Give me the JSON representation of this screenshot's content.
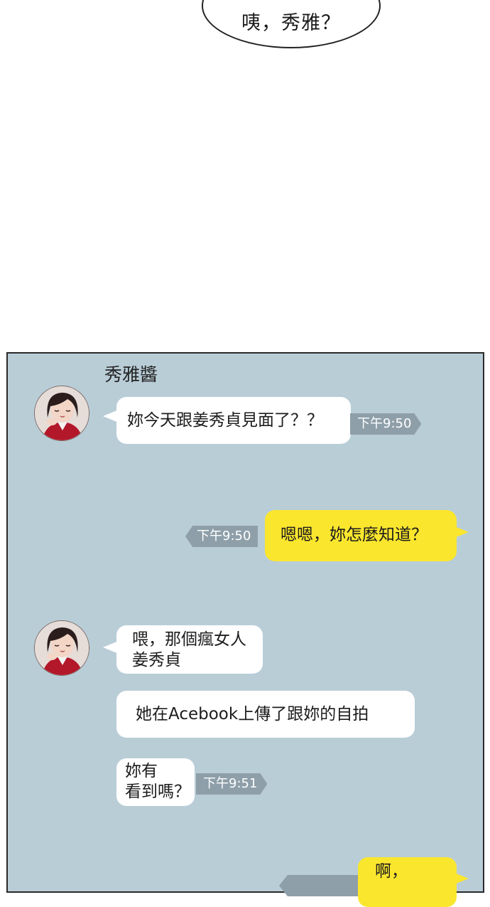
{
  "top_bubble": {
    "text": "咦，秀雅？"
  },
  "chat": {
    "sender_name": "秀雅醬",
    "messages": [
      {
        "from": "other",
        "text": "妳今天跟姜秀貞見面了？？",
        "time": "下午9:50"
      },
      {
        "from": "me",
        "text": "嗯嗯，妳怎麼知道？",
        "time": "下午9:50"
      },
      {
        "from": "other",
        "text": "喂，那個瘋女人\n姜秀貞",
        "time": ""
      },
      {
        "from": "other",
        "text": "她在Acebook上傳了跟妳的自拍",
        "time": ""
      },
      {
        "from": "other",
        "text": "妳有\n看到嗎？",
        "time": "下午9:51"
      },
      {
        "from": "me",
        "text": "啊，",
        "time": ""
      }
    ]
  },
  "colors": {
    "chat_background": "#b9cdd7",
    "my_bubble": "#fbe62e",
    "other_bubble": "#ffffff",
    "time_tag": "#8e9fa9"
  }
}
